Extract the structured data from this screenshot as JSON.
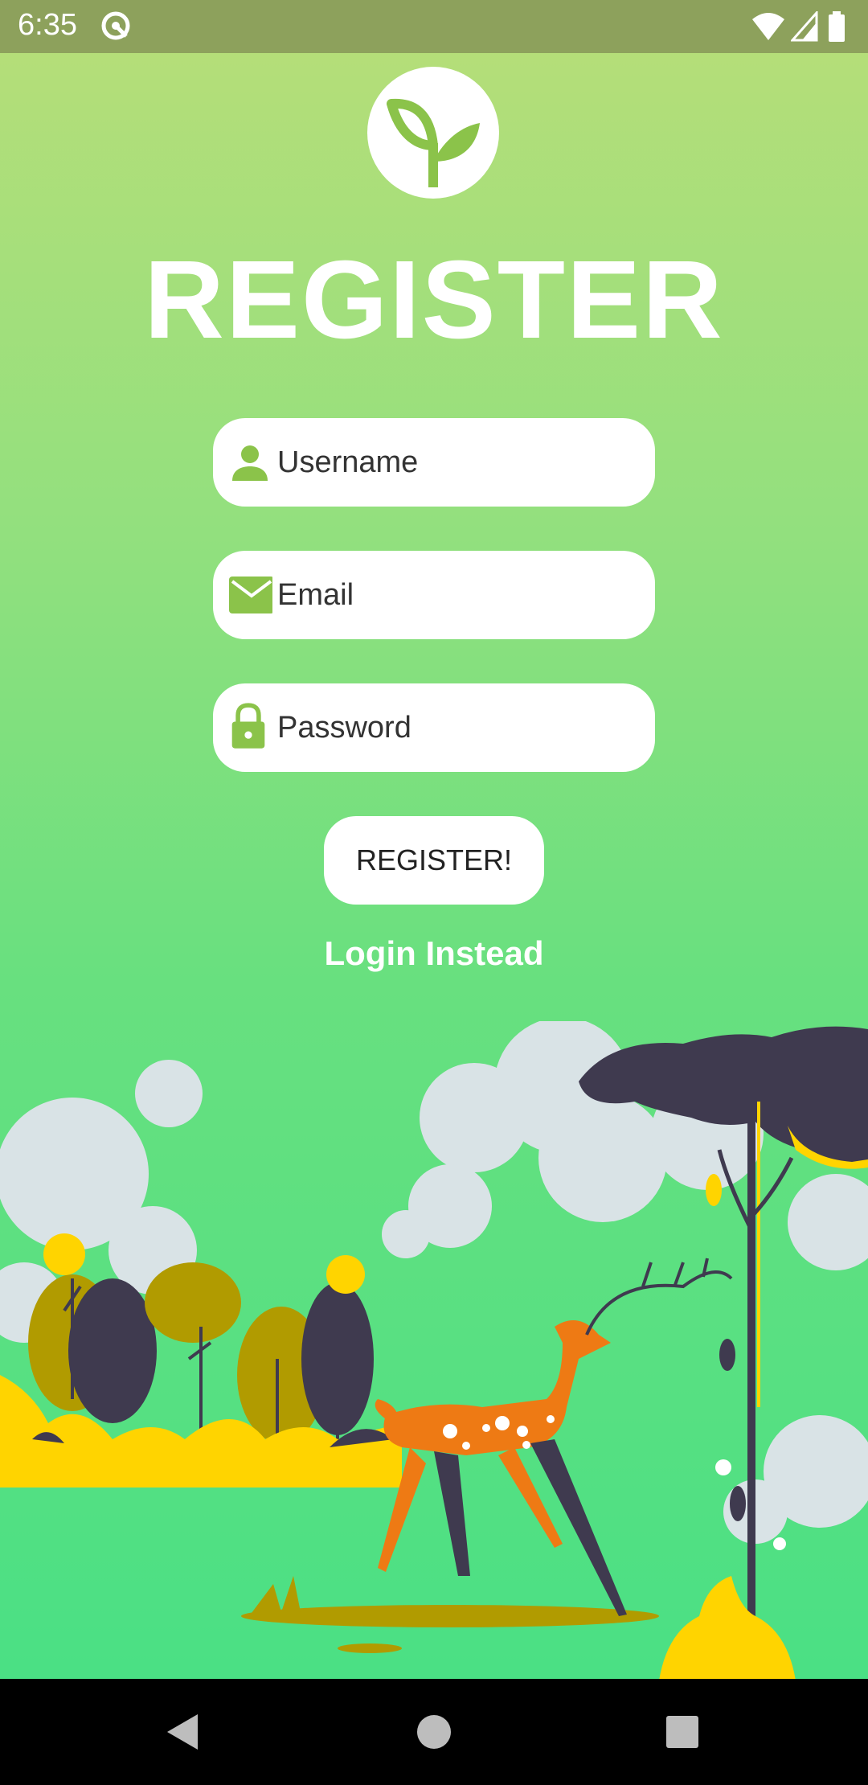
{
  "status_bar": {
    "time": "6:35",
    "left_icon": "vpn-key-icon",
    "right_icons": [
      "wifi-icon",
      "signal-icon",
      "battery-icon"
    ]
  },
  "app": {
    "logo_icon": "leaf-sprout-icon",
    "title": "REGISTER"
  },
  "form": {
    "username": {
      "placeholder": "Username",
      "icon": "person-icon"
    },
    "email": {
      "placeholder": "Email",
      "icon": "mail-icon"
    },
    "password": {
      "placeholder": "Password",
      "icon": "lock-icon"
    },
    "submit_label": "REGISTER!",
    "login_link": "Login Instead"
  },
  "colors": {
    "accent_green": "#8bc34a",
    "status_bar": "#8da15c",
    "background_top": "#b8de78",
    "background_bottom": "#46e085"
  },
  "nav_bar": {
    "buttons": [
      "back-icon",
      "home-icon",
      "recents-icon"
    ]
  }
}
